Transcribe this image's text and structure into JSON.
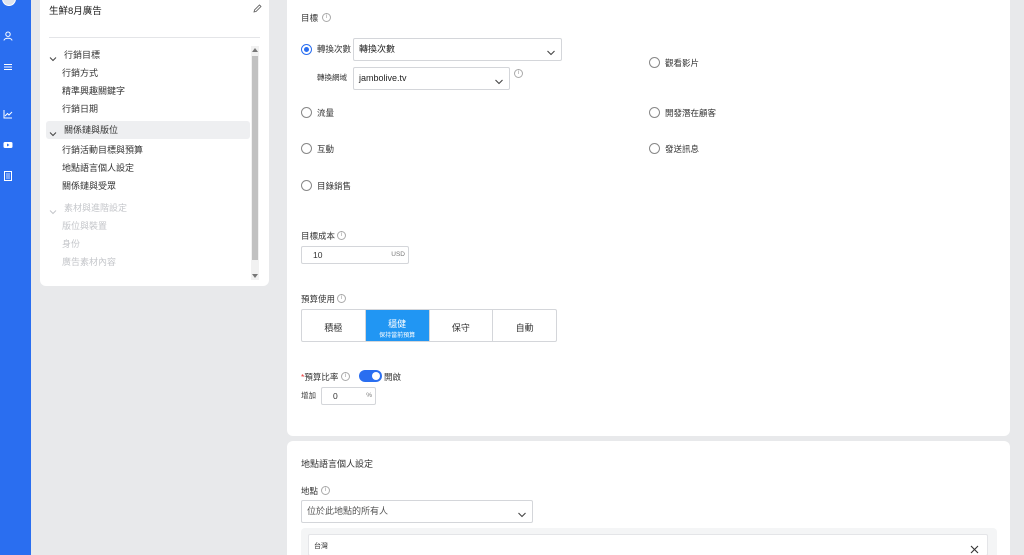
{
  "sidebar_rail": {
    "icons": [
      "avatar",
      "user-icon",
      "menu-icon",
      "chart-icon",
      "video-icon",
      "document-icon"
    ]
  },
  "nav": {
    "campaign_title": "生鮮8月廣告",
    "sections": [
      {
        "label": "行銷目標",
        "expanded": true,
        "faded": false,
        "items": [
          "行銷方式",
          "精準興趣關鍵字",
          "行銷日期"
        ]
      },
      {
        "label": "關係鏈與版位",
        "expanded": true,
        "faded": false,
        "active": true,
        "items": [
          "行銷活動目標與預算",
          "地點語言個人設定",
          "關係鏈與受眾"
        ]
      },
      {
        "label": "素材與進階設定",
        "expanded": true,
        "faded": true,
        "items": [
          "版位與裝置",
          "身份",
          "廣告素材內容"
        ]
      }
    ]
  },
  "goal": {
    "label": "目標",
    "options": {
      "conversions": "轉換次數",
      "traffic": "流量",
      "engagement": "互動",
      "catalog_sales": "目錄銷售",
      "video_views": "觀看影片",
      "leads": "開發潛在顧客",
      "messages": "發送訊息"
    },
    "selected": "conversions",
    "conversion_select_value": "轉換次數",
    "conversion_domain_label": "轉換網域",
    "conversion_domain_value": "jambolive.tv"
  },
  "cost": {
    "label": "目標成本",
    "value": "10",
    "currency": "USD"
  },
  "budget": {
    "label": "預算使用",
    "options": [
      {
        "label": "積極",
        "sub": ""
      },
      {
        "label": "穩健",
        "sub": "保持當前預算"
      },
      {
        "label": "保守",
        "sub": ""
      },
      {
        "label": "自動",
        "sub": ""
      }
    ],
    "selected_index": 1
  },
  "ratio": {
    "required_mark": "*",
    "label": "預算比率",
    "toggle_label": "開啟",
    "toggle_on": true,
    "increase_label": "增加",
    "increase_value": "0",
    "increase_unit": "%"
  },
  "location": {
    "section_title": "地點語言個人設定",
    "label": "地點",
    "select_value": "位於此地點的所有人",
    "tag": "台灣"
  },
  "colors": {
    "accent": "#2a6ef0",
    "segment_active": "#2196f3",
    "required": "#ee3333"
  }
}
